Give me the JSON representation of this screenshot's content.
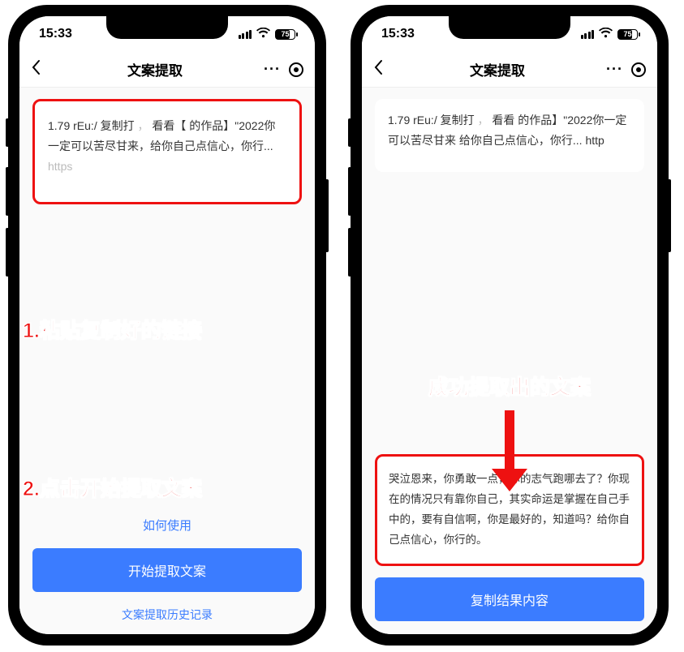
{
  "status": {
    "time": "15:33",
    "battery": "75"
  },
  "nav": {
    "title": "文案提取"
  },
  "left": {
    "input_text_visible": "1.79 rEu:/ 复制打",
    "input_text_mid": "   看看【",
    "input_text_tail": "的作品】\"2022你一定可以苦尽甘来，给你自己点信心，你行... ",
    "input_text_url": "https",
    "annotation1": "1.粘贴复制好的链接",
    "annotation2": "2.点击开始提取文案",
    "how_to": "如何使用",
    "start_btn": "开始提取文案",
    "history": "文案提取历史记录"
  },
  "right": {
    "input_text_a": "1.79 rEu:/ 复制打",
    "input_text_b": "   看看",
    "input_text_c": "的作品】\"2022你一定可以苦尽甘来  给你自己点信心，你行... http",
    "annotation": "成功提取出的文案",
    "result_text": "哭泣恩来，你勇敢一点，你的志气跑哪去了？你现在的情况只有靠你自己，其实命运是掌握在自己手中的，要有自信啊，你是最好的，知道吗？给你自己点信心，你行的。",
    "copy_btn": "复制结果内容"
  }
}
